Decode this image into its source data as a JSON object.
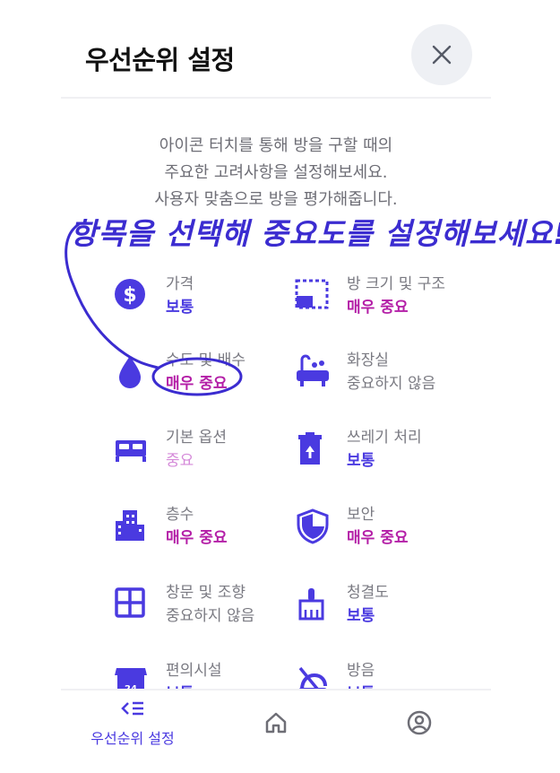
{
  "header": {
    "title": "우선순위 설정"
  },
  "description": {
    "lines": [
      "아이콘 터치를 통해 방을 구할 때의",
      "주요한 고려사항을 설정해보세요.",
      "사용자 맞춤으로 방을 평가해줍니다."
    ]
  },
  "overlay": {
    "handwritten_text": "항목을 선택해 중요도를 설정해보세요!"
  },
  "items": [
    {
      "label": "가격",
      "value": "보통",
      "icon": "dollar-icon"
    },
    {
      "label": "방 크기 및 구조",
      "value": "매우 중요",
      "icon": "room-size-icon"
    },
    {
      "label": "수도 및 배수",
      "value": "매우 중요",
      "icon": "water-drop-icon"
    },
    {
      "label": "화장실",
      "value": "중요하지 않음",
      "icon": "bathtub-icon"
    },
    {
      "label": "기본 옵션",
      "value": "중요",
      "icon": "bed-icon"
    },
    {
      "label": "쓰레기 처리",
      "value": "보통",
      "icon": "trash-icon"
    },
    {
      "label": "층수",
      "value": "매우 중요",
      "icon": "building-icon"
    },
    {
      "label": "보안",
      "value": "매우 중요",
      "icon": "shield-icon"
    },
    {
      "label": "창문 및 조향",
      "value": "중요하지 않음",
      "icon": "window-icon"
    },
    {
      "label": "청결도",
      "value": "보통",
      "icon": "broom-icon"
    },
    {
      "label": "편의시설",
      "value": "보통",
      "icon": "store-icon"
    },
    {
      "label": "방음",
      "value": "보통",
      "icon": "mute-icon"
    }
  ],
  "bottom_nav": [
    {
      "label": "우선순위 설정",
      "icon": "priority-list-icon"
    },
    {
      "label": "",
      "icon": "home-icon"
    },
    {
      "label": "",
      "icon": "profile-icon"
    }
  ],
  "colors": {
    "accent": "#4a3ae0",
    "very_important": "#b41fa7",
    "important": "#d58ad9",
    "not_important": "#7a7a82",
    "annotation": "#3b2cd0"
  }
}
